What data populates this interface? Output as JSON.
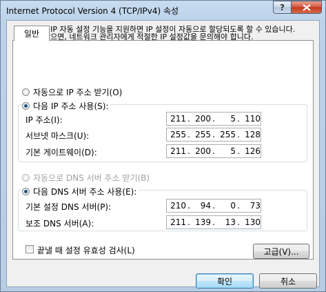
{
  "window": {
    "title": "Internet Protocol Version 4 (TCP/IPv4) 속성",
    "help_label": "?",
    "close_label": "x"
  },
  "tabs": [
    {
      "label": "일반"
    }
  ],
  "description": "네트워크가 IP 자동 설정 기능을 지원하면 IP 설정이 자동으로 할당되도록 할 수 있습니다. 지원하지 않으면, 네트워크 관리자에게 적절한 IP 설정값을 문의해야 합니다.",
  "ip": {
    "auto_label": "자동으로 IP 주소 받기(O)",
    "manual_label": "다음 IP 주소 사용(S):",
    "selected": "manual",
    "address_label": "IP 주소(I):",
    "address": [
      "211",
      "200",
      "5",
      "110"
    ],
    "subnet_label": "서브넷 마스크(U):",
    "subnet": [
      "255",
      "255",
      "255",
      "128"
    ],
    "gateway_label": "기본 게이트웨이(D):",
    "gateway": [
      "211",
      "200",
      "5",
      "126"
    ]
  },
  "dns": {
    "auto_label": "자동으로 DNS 서버 주소 받기(B)",
    "manual_label": "다음 DNS 서버 주소 사용(E):",
    "selected": "manual",
    "preferred_label": "기본 설정 DNS 서버(P):",
    "preferred": [
      "210",
      "94",
      "0",
      "73"
    ],
    "alternate_label": "보조 DNS 서버(A):",
    "alternate": [
      "211",
      "139",
      "13",
      "130"
    ]
  },
  "validate_label": "끝낼 때 설정 유효성 검사(L)",
  "validate_checked": false,
  "advanced_label": "고급(V)...",
  "ok_label": "확인",
  "cancel_label": "취소"
}
